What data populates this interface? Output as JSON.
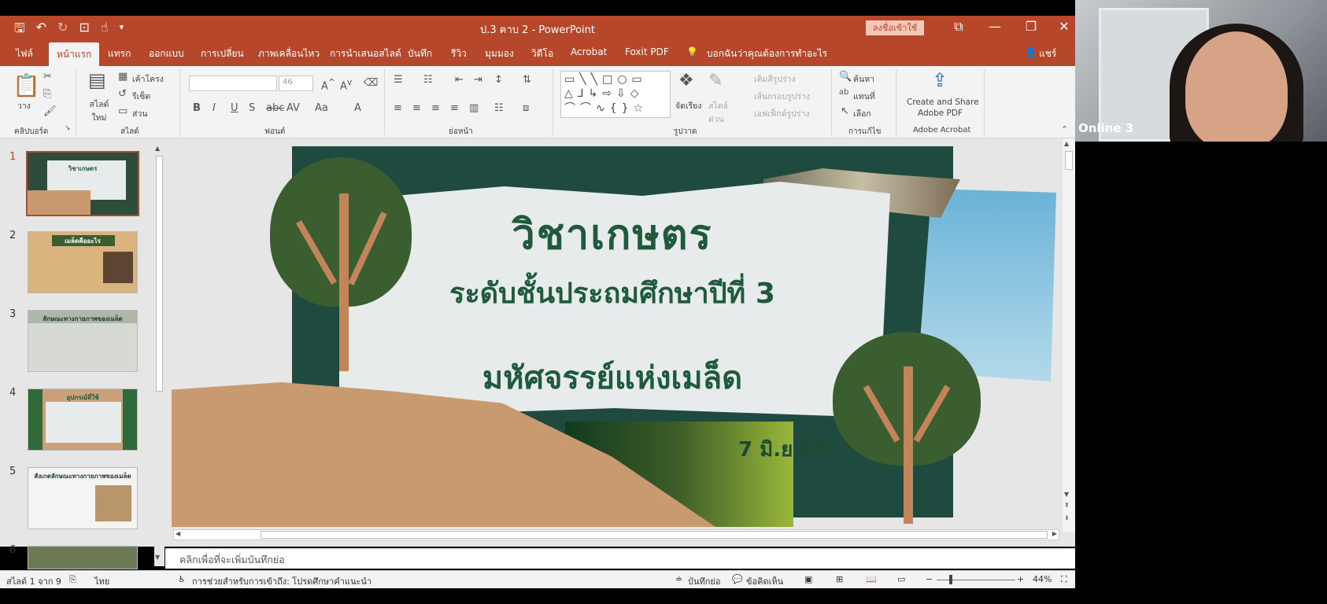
{
  "titlebar": {
    "document_title": "ป.3 ฅาบ 2  -  PowerPoint",
    "signin_label": "ลงชื่อเข้าใช้"
  },
  "tabs": [
    {
      "label": "ไฟล์"
    },
    {
      "label": "หน้าแรก"
    },
    {
      "label": "แทรก"
    },
    {
      "label": "ออกแบบ"
    },
    {
      "label": "การเปลี่ยน"
    },
    {
      "label": "ภาพเคลื่อนไหว"
    },
    {
      "label": "การนำเสนอสไลด์"
    },
    {
      "label": "บันทึก"
    },
    {
      "label": "รีวิว"
    },
    {
      "label": "มุมมอง"
    },
    {
      "label": "วิดีโอ"
    },
    {
      "label": "Acrobat"
    },
    {
      "label": "Foxit PDF"
    }
  ],
  "tellme": "บอกฉันว่าคุณต้องการทำอะไร",
  "user_label": "แชร์",
  "ribbon": {
    "clipboard": {
      "paste": "วาง",
      "label": "คลิปบอร์ด"
    },
    "slides": {
      "new_slide": "สไลด์ใหม่",
      "layout": "เค้าโครง",
      "reset": "รีเซ็ต",
      "section": "ส่วน",
      "label": "สไลด์"
    },
    "font": {
      "size": "46",
      "label": "ฟอนต์"
    },
    "paragraph": {
      "label": "ย่อหน้า"
    },
    "drawing": {
      "arrange": "จัดเรียง",
      "quick_styles": "สไตล์ด่วน",
      "fill": "เติมสีรูปร่าง",
      "outline": "เส้นกรอบรูปร่าง",
      "effects": "เอฟเฟ็กต์รูปร่าง",
      "label": "รูปวาด"
    },
    "editing": {
      "find": "ค้นหา",
      "replace": "แทนที่",
      "select": "เลือก",
      "label": "การแก้ไข"
    },
    "acrobat": {
      "create_share": "Create and Share",
      "adobe_pdf": "Adobe PDF",
      "label": "Adobe Acrobat"
    }
  },
  "thumbnails": [
    {
      "number": "1",
      "title": "วิชาเกษตร"
    },
    {
      "number": "2",
      "title": "เมล็ดคืออะไร"
    },
    {
      "number": "3",
      "title": "ลักษณะทางกายภาพของเมล็ด"
    },
    {
      "number": "4",
      "title": "อุปกรณ์ที่ใช้"
    },
    {
      "number": "5",
      "title": "สังเกตลักษณะทางกายภาพของเมล็ด"
    },
    {
      "number": "6",
      "title": ""
    }
  ],
  "slide": {
    "title": "วิชาเกษตร",
    "subtitle1": "ระดับชั้นประถมศึกษาปีที่ 3",
    "subtitle2": "มหัศจรรย์แห่งเมล็ด",
    "date": "7 มิ.ย.65"
  },
  "notes_placeholder": "คลิกเพื่อที่จะเพิ่มบันทึกย่อ",
  "status": {
    "slide_info": "สไลด์ 1 จาก 9",
    "language": "ไทย",
    "accessibility": "การช่วยสำหรับการเข้าถึง: โปรดศึกษาคำแนะนำ",
    "notes": "บันทึกย่อ",
    "comments": "ข้อคิดเห็น",
    "zoom": "44%"
  },
  "webcam": {
    "label": "Online 3"
  },
  "colors": {
    "accent": "#b7472a",
    "slide_green": "#1f5a3c"
  }
}
